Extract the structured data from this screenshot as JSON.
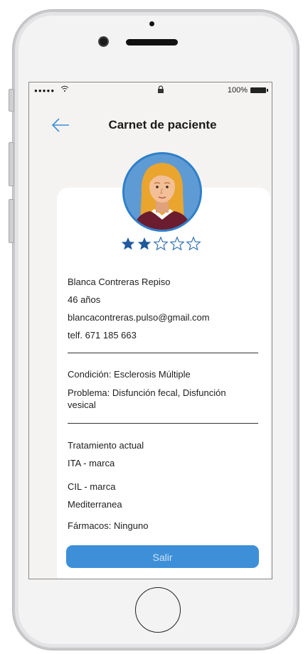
{
  "statusbar": {
    "signal": "●●●●●",
    "battery_text": "100%"
  },
  "navbar": {
    "title": "Carnet de paciente",
    "back_icon": "arrow-left-icon"
  },
  "profile": {
    "avatar_icon": "user-avatar",
    "rating": 2,
    "rating_max": 5,
    "star_color": "#1f5a9c"
  },
  "patient": {
    "name": "Blanca Contreras Repiso",
    "age": "46 años",
    "email": "blancacontreras.pulso@gmail.com",
    "phone": "telf. 671 185 663"
  },
  "condition": {
    "condition": "Condición: Esclerosis Múltiple",
    "problem": "Problema: Disfunción fecal, Disfunción vesical"
  },
  "treatment": {
    "heading": "Tratamiento actual",
    "items": [
      "ITA - marca",
      "CIL - marca",
      "Mediterranea",
      "Fármacos: Ninguno"
    ]
  },
  "actions": {
    "exit_label": "Salir"
  },
  "colors": {
    "accent": "#3d8fd8",
    "avatar_border": "#2f7fc9"
  }
}
